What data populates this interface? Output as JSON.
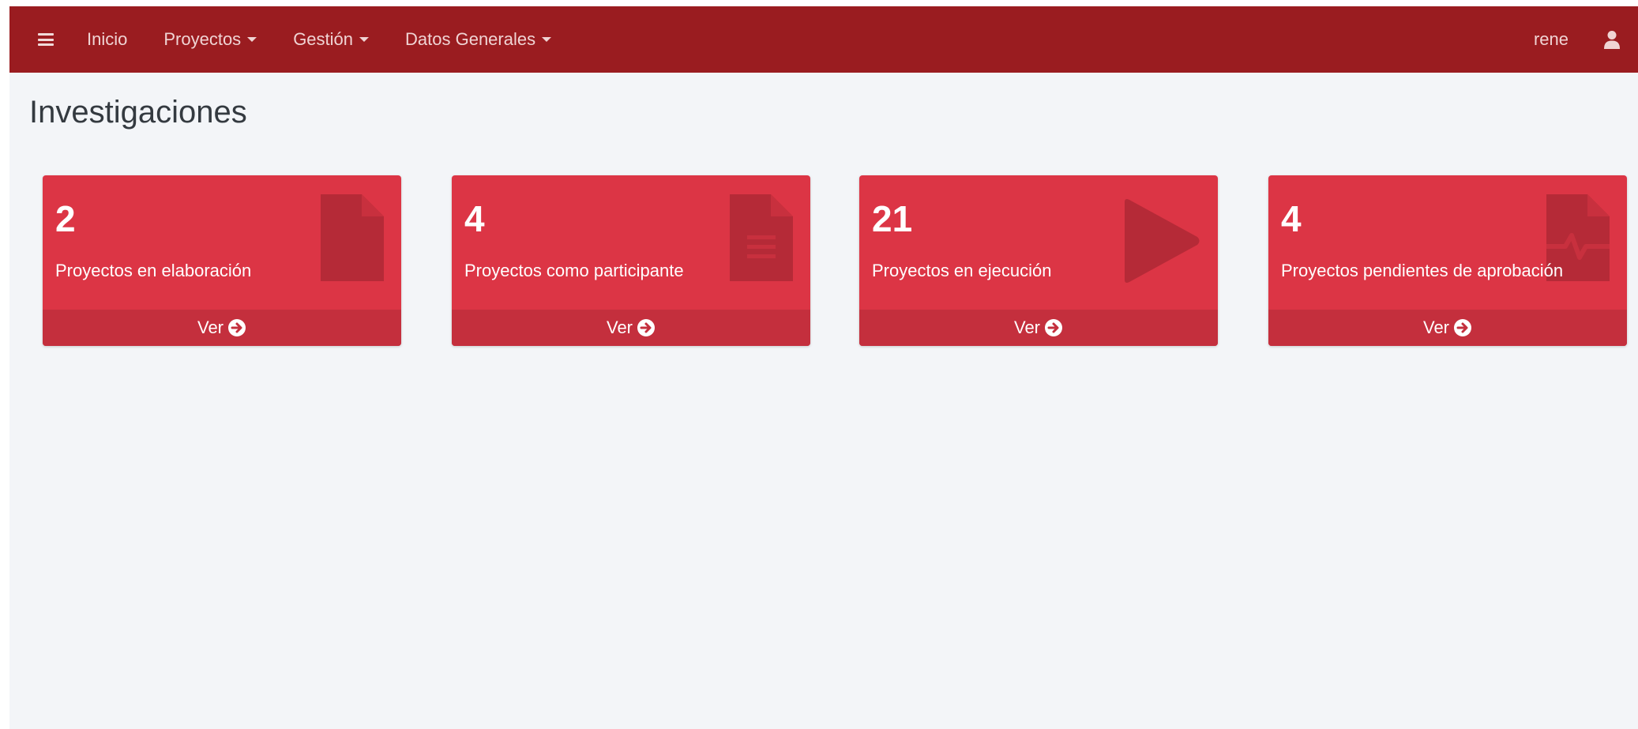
{
  "nav": {
    "items": [
      {
        "label": "Inicio"
      },
      {
        "label": "Proyectos"
      },
      {
        "label": "Gestión"
      },
      {
        "label": "Datos Generales"
      }
    ],
    "user": "rene"
  },
  "page": {
    "title": "Investigaciones"
  },
  "cards": [
    {
      "count": "2",
      "label": "Proyectos en elaboración",
      "link": "Ver",
      "icon": "file-icon"
    },
    {
      "count": "4",
      "label": "Proyectos como participante",
      "link": "Ver",
      "icon": "file-text-icon"
    },
    {
      "count": "21",
      "label": "Proyectos en ejecución",
      "link": "Ver",
      "icon": "play-icon"
    },
    {
      "count": "4",
      "label": "Proyectos pendientes de aprobación",
      "link": "Ver",
      "icon": "file-pulse-icon"
    }
  ],
  "colors": {
    "navbar": "#9a1c20",
    "card": "#dc3545",
    "card_footer": "#c42f3d",
    "background": "#f3f5f8"
  }
}
